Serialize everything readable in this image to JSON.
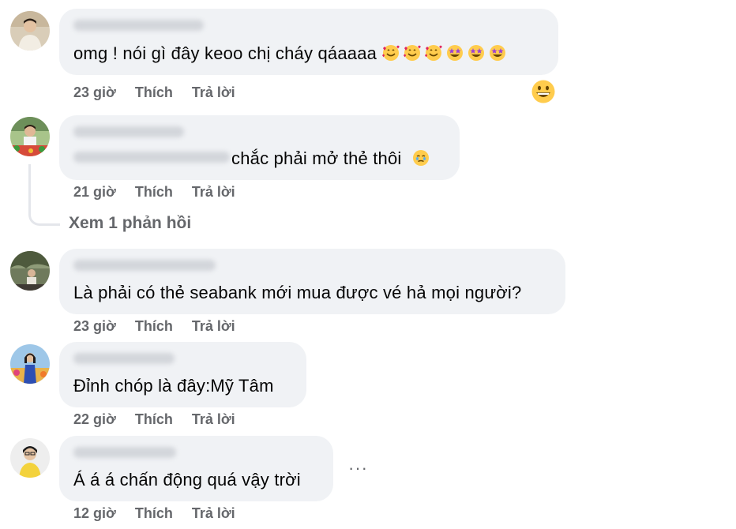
{
  "comments": [
    {
      "text": "omg ! nói gì đây keoo chị cháy qáaaaa",
      "emoji": [
        "smiling-face-with-hearts",
        "smiling-face-with-hearts",
        "smiling-face-with-hearts",
        "star-struck",
        "star-struck",
        "star-struck"
      ],
      "time": "23 giờ",
      "like": "Thích",
      "reply": "Trả lời",
      "reaction": "grinning-face"
    },
    {
      "text": "chắc phải mở thẻ thôi",
      "emoji": [
        "face-holding-back-tears"
      ],
      "time": "21 giờ",
      "like": "Thích",
      "reply": "Trả lời",
      "view_replies": "Xem 1 phản hồi"
    },
    {
      "text": "Là phải có thẻ seabank mới mua được vé hả mọi người?",
      "time": "23 giờ",
      "like": "Thích",
      "reply": "Trả lời"
    },
    {
      "text": "Đỉnh chóp là đây:Mỹ Tâm",
      "time": "22 giờ",
      "like": "Thích",
      "reply": "Trả lời"
    },
    {
      "text": "Á á á chấn động quá vậy trời",
      "time": "12 giờ",
      "like": "Thích",
      "reply": "Trả lời",
      "more": "···"
    }
  ],
  "colors": {
    "bubble": "#f0f2f5",
    "meta": "#65676b",
    "text": "#050505",
    "thread_line": "#e4e6eb"
  }
}
